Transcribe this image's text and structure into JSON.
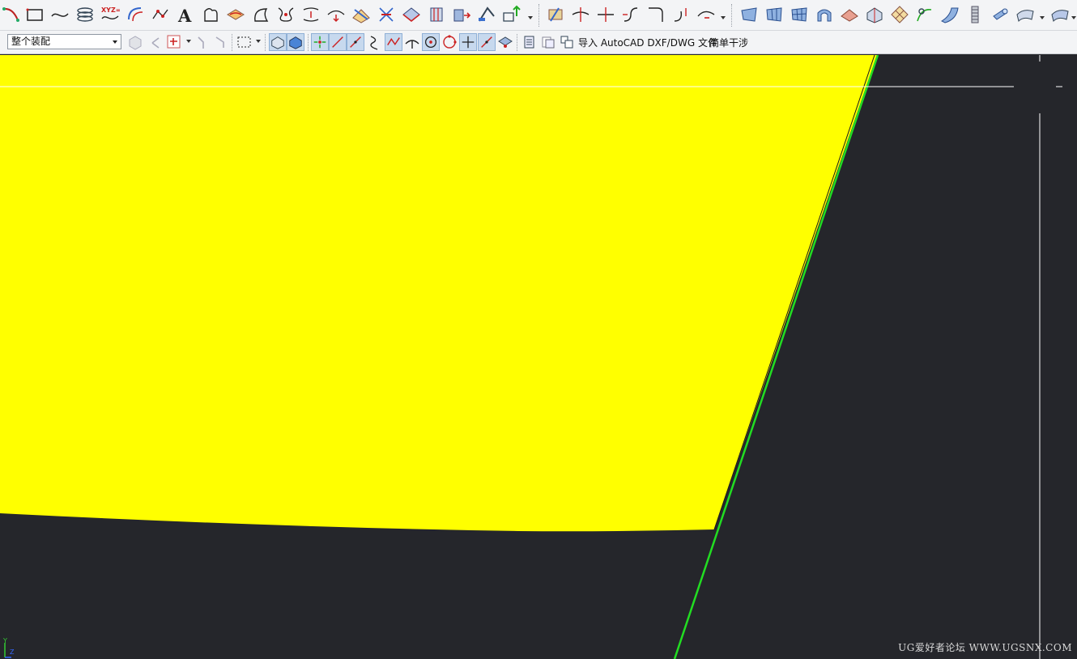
{
  "toolbar_top": {
    "icons": [
      "arc-icon",
      "rectangle-icon",
      "spline-icon",
      "helix-icon",
      "law-curve-icon",
      "offset-curve-icon",
      "point-set-icon",
      "text-icon",
      "sketch-icon",
      "project-curve-icon",
      "offset-surface-curve-icon",
      "bridge-curve-icon",
      "combined-curve-icon",
      "wrap-curve-icon",
      "intersection-curve-icon",
      "section-curve-icon",
      "extract-curve-icon",
      "isoparametric-curve-icon",
      "extrude-icon",
      "revolve-icon",
      "datum-plane-icon",
      "more-icon",
      "trim-curve-icon",
      "trim-corner-icon",
      "divide-curve-icon",
      "curve-length-icon",
      "fillet-curve-icon",
      "join-curve-icon",
      "edit-curve-icon",
      "ruled-surface-icon",
      "through-curves-icon",
      "through-mesh-icon",
      "swept-icon",
      "n-sided-surface-icon",
      "extension-icon",
      "transition-icon",
      "studio-surface-icon",
      "face-blend-icon",
      "spring-icon",
      "tube-icon",
      "sheet-icon"
    ]
  },
  "toolbar_second": {
    "assembly_select": "整个装配",
    "import_label": "导入 AutoCAD DXF/DWG 文件",
    "clearance_label": "简单干涉"
  },
  "viewport": {
    "watermark": "UG爱好者论坛 WWW.UGSNX.COM",
    "background_color": "#25262b",
    "fill_color": "#ffff00",
    "edge_color": "#22dd22"
  }
}
